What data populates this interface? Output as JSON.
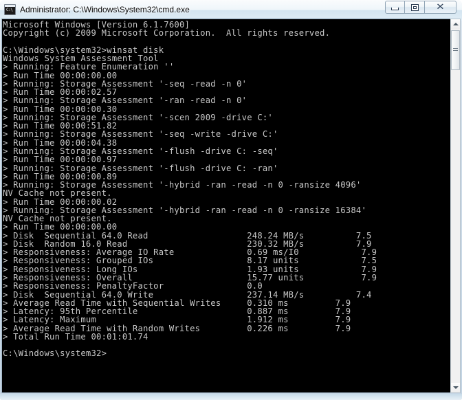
{
  "window": {
    "title": "Administrator: C:\\Windows\\System32\\cmd.exe",
    "icon": "cmd-console-icon",
    "prompt_glyph": "C:\\",
    "minimize_label": "Minimize",
    "maximize_label": "Maximize",
    "close_label": "Close",
    "close_glyph": "✕"
  },
  "scrollbar": {
    "up_label": "Scroll up",
    "down_label": "Scroll down",
    "thumb_label": "Scroll thumb"
  },
  "console": {
    "foreground": "#c8c8c8",
    "background": "#000000",
    "lines": [
      "Microsoft Windows [Version 6.1.7600]",
      "Copyright (c) 2009 Microsoft Corporation.  All rights reserved.",
      "",
      "C:\\Windows\\system32>winsat disk",
      "Windows System Assessment Tool",
      "> Running: Feature Enumeration ''",
      "> Run Time 00:00:00.00",
      "> Running: Storage Assessment '-seq -read -n 0'",
      "> Run Time 00:00:02.57",
      "> Running: Storage Assessment '-ran -read -n 0'",
      "> Run Time 00:00:00.30",
      "> Running: Storage Assessment '-scen 2009 -drive C:'",
      "> Run Time 00:00:51.82",
      "> Running: Storage Assessment '-seq -write -drive C:'",
      "> Run Time 00:00:04.38",
      "> Running: Storage Assessment '-flush -drive C: -seq'",
      "> Run Time 00:00:00.97",
      "> Running: Storage Assessment '-flush -drive C: -ran'",
      "> Run Time 00:00:00.89",
      "> Running: Storage Assessment '-hybrid -ran -read -n 0 -ransize 4096'",
      "NV Cache not present.",
      "> Run Time 00:00:00.02",
      "> Running: Storage Assessment '-hybrid -ran -read -n 0 -ransize 16384'",
      "NV Cache not present.",
      "> Run Time 00:00:00.00",
      "> Disk  Sequential 64.0 Read                   248.24 MB/s          7.5",
      "> Disk  Random 16.0 Read                       230.32 MB/s          7.9",
      "> Responsiveness: Average IO Rate              0.69 ms/I0            7.9",
      "> Responsiveness: Grouped IOs                  8.17 units            7.5",
      "> Responsiveness: Long IOs                     1.93 units            7.9",
      "> Responsiveness: Overall                      15.77 units           7.9",
      "> Responsiveness: PenaltyFactor                0.0",
      "> Disk  Sequential 64.0 Write                  237.14 MB/s          7.4",
      "> Average Read Time with Sequential Writes     0.310 ms         7.9",
      "> Latency: 95th Percentile                     0.887 ms         7.9",
      "> Latency: Maximum                             1.912 ms         7.9",
      "> Average Read Time with Random Writes         0.226 ms         7.9",
      "> Total Run Time 00:01:01.74",
      "",
      "C:\\Windows\\system32>"
    ]
  }
}
